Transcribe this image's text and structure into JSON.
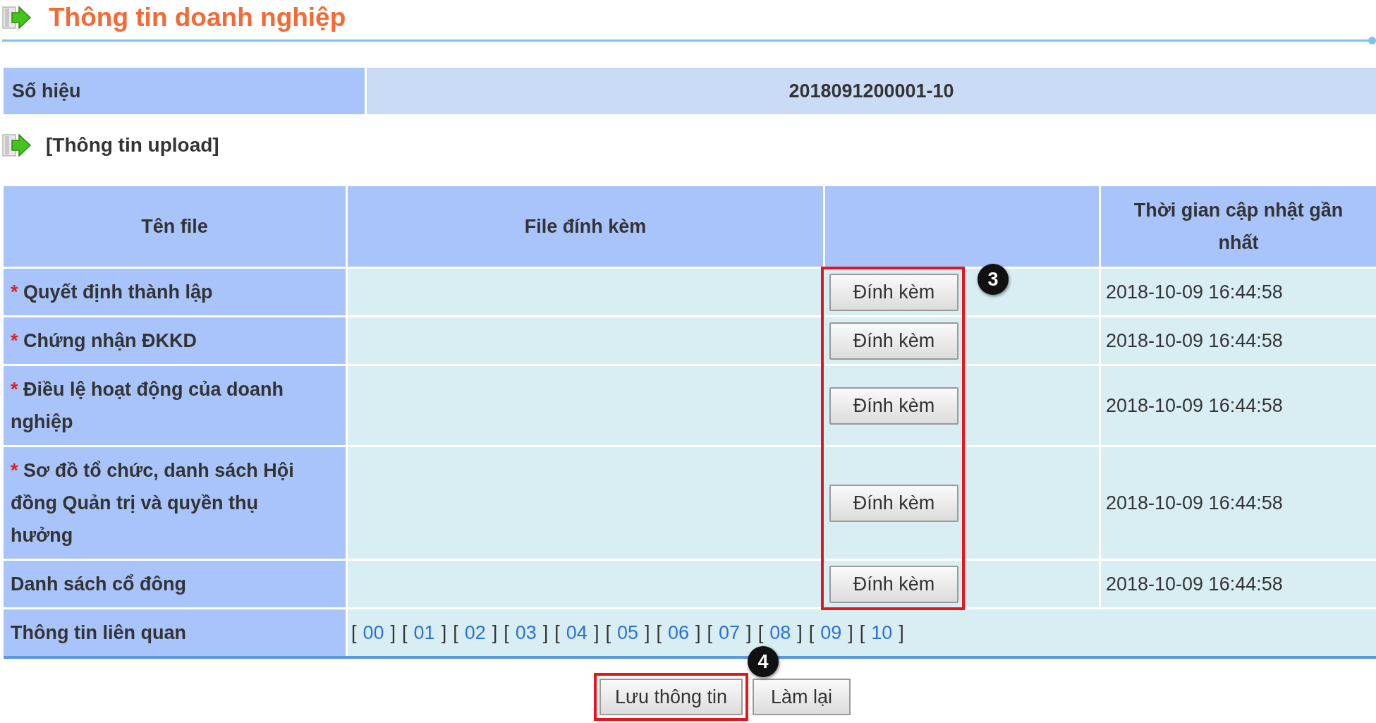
{
  "title": "Thông tin doanh nghiệp",
  "record": {
    "label": "Số hiệu",
    "value": "2018091200001-10"
  },
  "section_title": "[Thông tin upload]",
  "table": {
    "columns": [
      "Tên file",
      "File đính kèm",
      "",
      "Thời gian cập nhật gần nhất"
    ],
    "rows": [
      {
        "name": "Quyết định thành lập",
        "required": true,
        "action": "Đính kèm",
        "updated": "2018-10-09 16:44:58"
      },
      {
        "name": "Chứng nhận ĐKKD",
        "required": true,
        "action": "Đính kèm",
        "updated": "2018-10-09 16:44:58"
      },
      {
        "name": "Điều lệ hoạt động của doanh nghiệp",
        "required": true,
        "action": "Đính kèm",
        "updated": "2018-10-09 16:44:58"
      },
      {
        "name": "Sơ đồ tổ chức, danh sách Hội đồng Quản trị và quyền thụ hưởng",
        "required": true,
        "action": "Đính kèm",
        "updated": "2018-10-09 16:44:58"
      },
      {
        "name": "Danh sách cổ đông",
        "required": false,
        "action": "Đính kèm",
        "updated": "2018-10-09 16:44:58"
      }
    ],
    "related": {
      "label": "Thông tin liên quan",
      "open_bracket": "[",
      "close_bracket": "]",
      "required_mark": "*",
      "links": [
        "00",
        "01",
        "02",
        "03",
        "04",
        "05",
        "06",
        "07",
        "08",
        "09",
        "10"
      ]
    }
  },
  "buttons": [
    "Lưu thông tin",
    "Làm lại"
  ],
  "callouts": [
    "3",
    "4"
  ]
}
